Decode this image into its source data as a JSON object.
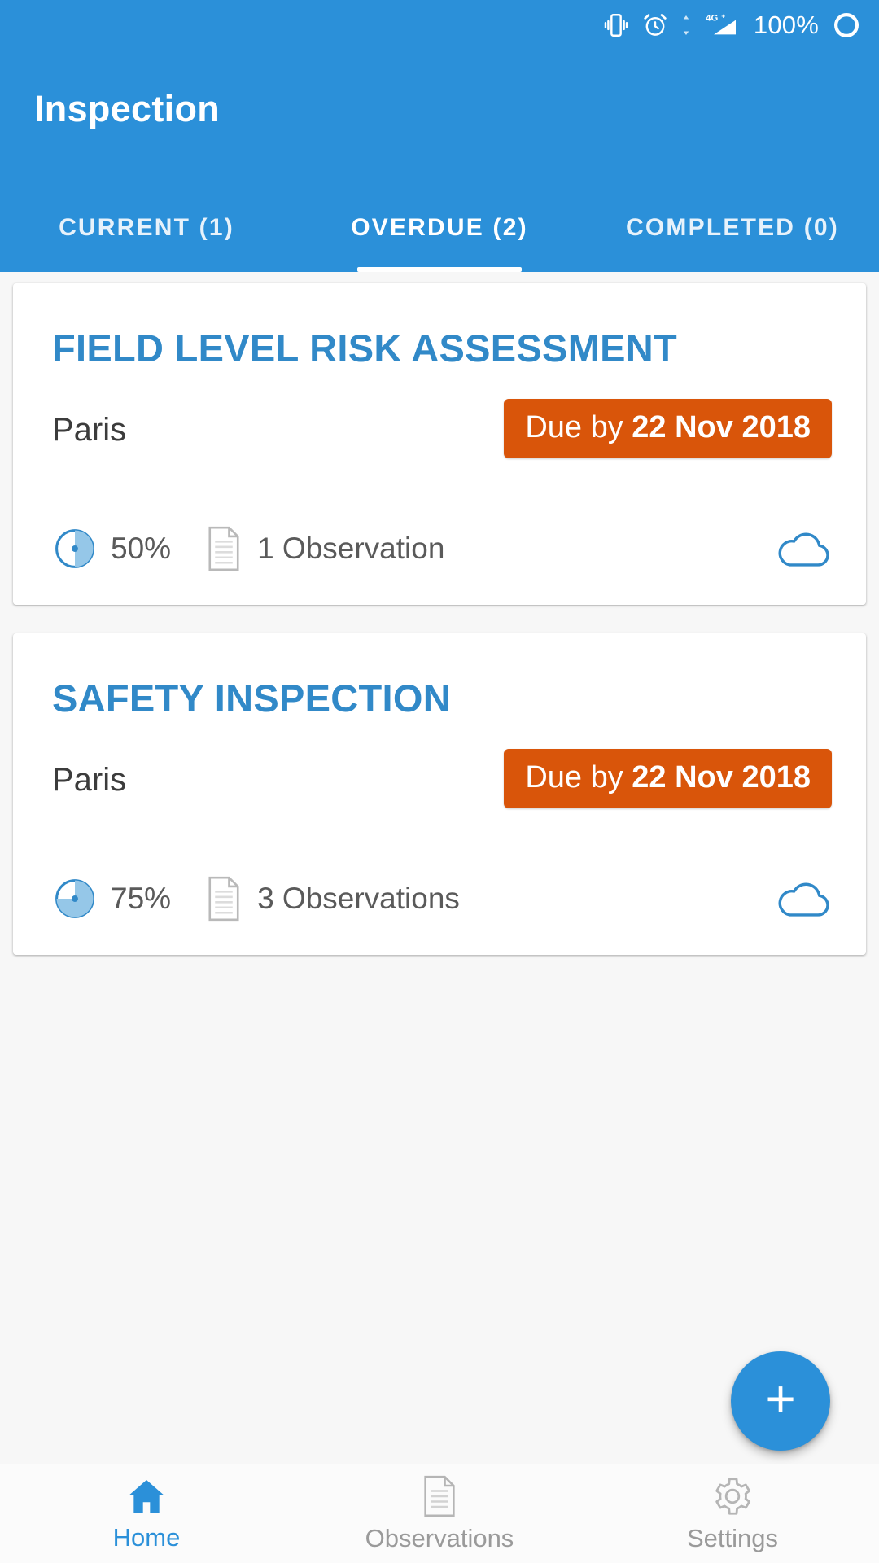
{
  "statusbar": {
    "icons": [
      "vibrate-icon",
      "alarm-icon",
      "data-transfer-icon",
      "signal-4g-icon"
    ],
    "network_label": "4G+",
    "battery_text": "100%",
    "battery_icon": "battery-full-circle-icon"
  },
  "appbar": {
    "title": "Inspection",
    "accent_color": "#2b90d9"
  },
  "tabs": [
    {
      "label": "CURRENT (1)",
      "active": false
    },
    {
      "label": "OVERDUE (2)",
      "active": true
    },
    {
      "label": "COMPLETED (0)",
      "active": false
    }
  ],
  "cards": [
    {
      "title": "FIELD LEVEL RISK ASSESSMENT",
      "location": "Paris",
      "due_prefix": "Due by ",
      "due_date": "22 Nov 2018",
      "due_color": "#d9550a",
      "progress_percent": "50%",
      "progress_value": 50,
      "observations": "1 Observation",
      "sync_icon": "cloud-icon"
    },
    {
      "title": "SAFETY INSPECTION",
      "location": "Paris",
      "due_prefix": "Due by ",
      "due_date": "22 Nov 2018",
      "due_color": "#d9550a",
      "progress_percent": "75%",
      "progress_value": 75,
      "observations": "3 Observations",
      "sync_icon": "cloud-icon"
    }
  ],
  "fab": {
    "label": "+",
    "icon": "plus-icon",
    "color": "#2b90d9"
  },
  "bottomnav": [
    {
      "label": "Home",
      "icon": "home-icon",
      "active": true
    },
    {
      "label": "Observations",
      "icon": "document-icon",
      "active": false
    },
    {
      "label": "Settings",
      "icon": "gear-icon",
      "active": false
    }
  ]
}
